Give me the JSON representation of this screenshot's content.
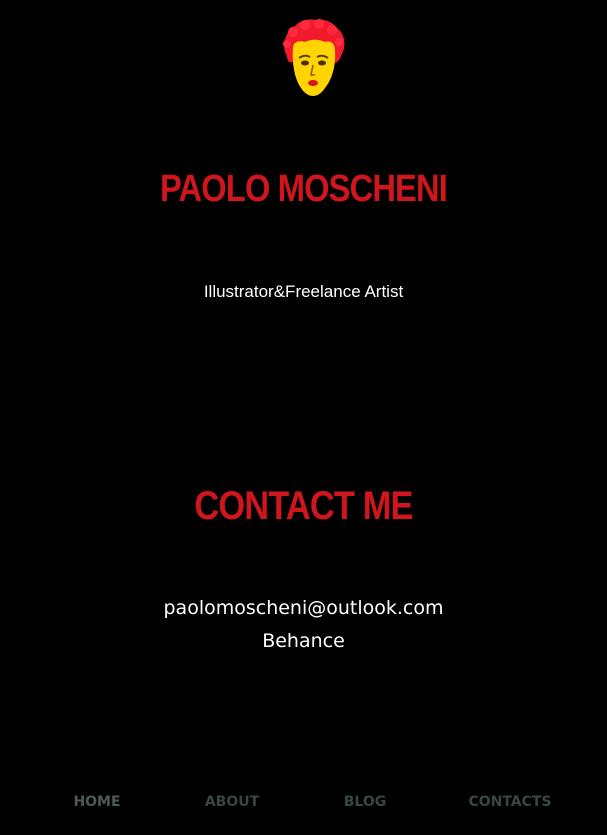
{
  "profile": {
    "name": "PAOLO MOSCHENI",
    "subtitle": "Illustrator&Freelance Artist"
  },
  "contact": {
    "heading": "CONTACT ME",
    "email": "paolomoscheni@outlook.com",
    "behance": "Behance"
  },
  "nav": {
    "items": [
      {
        "label": "HOME"
      },
      {
        "label": "ABOUT"
      },
      {
        "label": "BLOG"
      },
      {
        "label": "CONTACTS"
      }
    ]
  },
  "colors": {
    "background": "#000000",
    "accent_red": "#d0161c",
    "text_white": "#ffffff",
    "nav_active": "#4d5a58",
    "nav_inactive": "#3a4644",
    "avatar_hair": "#f21b2d",
    "avatar_face": "#ffd400"
  },
  "icons": {
    "avatar": "red-haired-face-avatar-icon"
  }
}
